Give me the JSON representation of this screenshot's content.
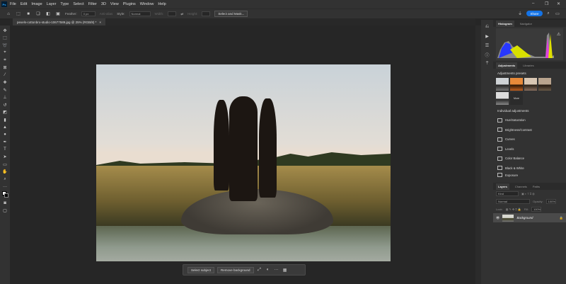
{
  "app": {
    "logo": "Ps",
    "menu": [
      "File",
      "Edit",
      "Image",
      "Layer",
      "Type",
      "Select",
      "Filter",
      "3D",
      "View",
      "Plugins",
      "Window",
      "Help"
    ],
    "window_controls": [
      "minimize",
      "restore",
      "close"
    ]
  },
  "options": {
    "feather_label": "Feather:",
    "feather_value": "0 px",
    "antialias": "Anti-alias",
    "style_label": "Style:",
    "style_value": "Normal",
    "width_label": "Width:",
    "height_label": "Height:",
    "select_mask": "Select and Mask...",
    "share": "Share"
  },
  "document": {
    "tab_title": "pexels-cottonbro-studio-10677589.jpg @ 25% (RGB/8) *",
    "close": "×"
  },
  "context_bar": {
    "select_subject": "Select subject",
    "remove_background": "Remove background",
    "more": "···"
  },
  "panels": {
    "histogram_tabs": [
      "Histogram",
      "Navigator"
    ],
    "adjust_tabs": [
      "Adjustments",
      "Libraries"
    ],
    "presets_title": "Adjustments presets",
    "more_label": "More",
    "individual_title": "Individual adjustments",
    "adjustments": [
      "Hue/Saturation",
      "Brightness/Contrast",
      "Curves",
      "Levels",
      "Color Balance",
      "Black & White",
      "Exposure"
    ],
    "layers_tabs": [
      "Layers",
      "Channels",
      "Paths"
    ],
    "search_placeholder": "Kind",
    "blend_mode": "Normal",
    "opacity_label": "Opacity:",
    "opacity_value": "100%",
    "lock_label": "Lock:",
    "fill_label": "Fill:",
    "fill_value": "100%",
    "layer_name": "Background"
  },
  "colors": {
    "accent": "#1473e6",
    "panel": "#323232",
    "canvas": "#262626"
  }
}
